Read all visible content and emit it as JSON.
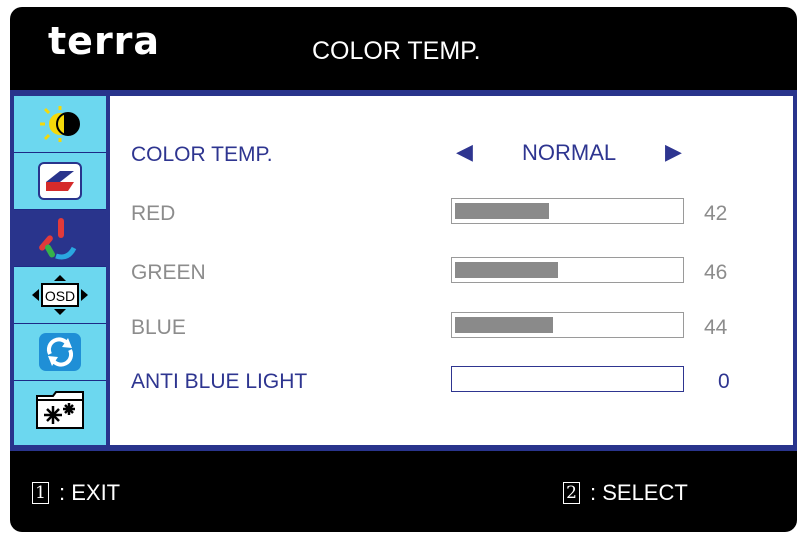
{
  "header": {
    "logo": "terra",
    "title": "COLOR TEMP."
  },
  "sidebar": {
    "items": [
      {
        "icon": "brightness-contrast-icon"
      },
      {
        "icon": "image-icon"
      },
      {
        "icon": "color-temp-icon"
      },
      {
        "icon": "osd-icon"
      },
      {
        "icon": "reset-icon"
      },
      {
        "icon": "setup-icon"
      }
    ],
    "active_index": 2
  },
  "menu": {
    "color_temp": {
      "label": "COLOR TEMP.",
      "value": "NORMAL"
    },
    "red": {
      "label": "RED",
      "value": "42"
    },
    "green": {
      "label": "GREEN",
      "value": "46"
    },
    "blue": {
      "label": "BLUE",
      "value": "44"
    },
    "anti_blue_light": {
      "label": "ANTI BLUE LIGHT",
      "value": "0"
    }
  },
  "footer": {
    "exit": {
      "key": "1",
      "label": ": EXIT"
    },
    "select": {
      "key": "2",
      "label": ": SELECT"
    }
  },
  "colors": {
    "frame": "#000000",
    "panel": "#29348c",
    "sidebar": "#6cd7ef",
    "accent": "#2e3590",
    "disabled": "#8c8c8c"
  }
}
